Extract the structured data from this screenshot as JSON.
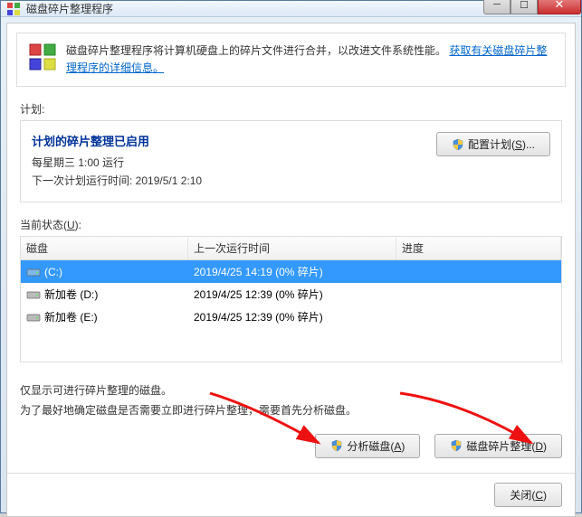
{
  "window": {
    "title": "磁盘碎片整理程序"
  },
  "info": {
    "description": "磁盘碎片整理程序将计算机硬盘上的碎片文件进行合并，以改进文件系统性能。",
    "link": "获取有关磁盘碎片整理程序的详细信息。"
  },
  "schedule": {
    "label": "计划:",
    "title": "计划的碎片整理已启用",
    "line1": "每星期三  1:00 运行",
    "line2": "下一次计划运行时间: 2019/5/1 2:10",
    "config_btn": "配置计划(",
    "config_key": "S",
    "config_btn_tail": ")..."
  },
  "status": {
    "label_pre": "当前状态(",
    "label_key": "U",
    "label_post": "):",
    "columns": {
      "disk": "磁盘",
      "last": "上一次运行时间",
      "progress": "进度"
    },
    "rows": [
      {
        "name": "(C:)",
        "last": "2019/4/25 14:19 (0% 碎片)",
        "selected": true,
        "type": "os"
      },
      {
        "name": "新加卷 (D:)",
        "last": "2019/4/25 12:39 (0% 碎片)",
        "selected": false,
        "type": "hdd"
      },
      {
        "name": "新加卷 (E:)",
        "last": "2019/4/25 12:39 (0% 碎片)",
        "selected": false,
        "type": "hdd"
      }
    ]
  },
  "note": {
    "line1": "仅显示可进行碎片整理的磁盘。",
    "line2": "为了最好地确定磁盘是否需要立即进行碎片整理，需要首先分析磁盘。"
  },
  "buttons": {
    "analyze_pre": "分析磁盘(",
    "analyze_key": "A",
    "analyze_post": ")",
    "defrag_pre": "磁盘碎片整理(",
    "defrag_key": "D",
    "defrag_post": ")",
    "close_pre": "关闭(",
    "close_key": "C",
    "close_post": ")"
  }
}
